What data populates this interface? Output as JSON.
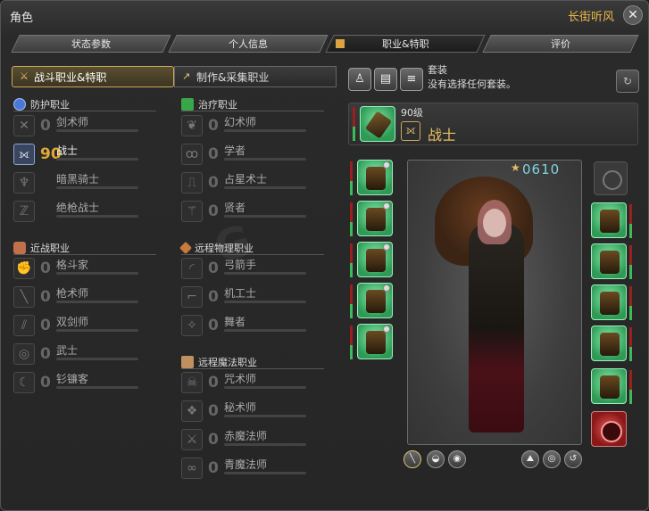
{
  "window": {
    "title": "角色",
    "character_name": "长街听风"
  },
  "tabs": [
    {
      "label": "状态参数"
    },
    {
      "label": "个人信息"
    },
    {
      "label": "职业&特职"
    },
    {
      "label": "评价"
    }
  ],
  "subtabs": [
    {
      "label": "战斗职业&特职"
    },
    {
      "label": "制作&采集职业"
    }
  ],
  "sections": {
    "tank": {
      "title": "防护职业",
      "jobs": [
        {
          "name": "剑术师",
          "level": "0"
        },
        {
          "name": "战士",
          "level": "90"
        },
        {
          "name": "暗黑骑士",
          "level": ""
        },
        {
          "name": "绝枪战士",
          "level": ""
        }
      ]
    },
    "melee": {
      "title": "近战职业",
      "jobs": [
        {
          "name": "格斗家",
          "level": "0"
        },
        {
          "name": "枪术师",
          "level": "0"
        },
        {
          "name": "双剑师",
          "level": "0"
        },
        {
          "name": "武士",
          "level": "0"
        },
        {
          "name": "钐镰客",
          "level": "0"
        }
      ]
    },
    "healer": {
      "title": "治疗职业",
      "jobs": [
        {
          "name": "幻术师",
          "level": "0"
        },
        {
          "name": "学者",
          "level": "0"
        },
        {
          "name": "占星术士",
          "level": "0"
        },
        {
          "name": "贤者",
          "level": "0"
        }
      ]
    },
    "ranged": {
      "title": "远程物理职业",
      "jobs": [
        {
          "name": "弓箭手",
          "level": "0"
        },
        {
          "name": "机工士",
          "level": "0"
        },
        {
          "name": "舞者",
          "level": "0"
        }
      ]
    },
    "caster": {
      "title": "远程魔法职业",
      "jobs": [
        {
          "name": "咒术师",
          "level": "0"
        },
        {
          "name": "秘术师",
          "level": "0"
        },
        {
          "name": "赤魔法师",
          "level": "0"
        },
        {
          "name": "青魔法师",
          "level": "0"
        }
      ]
    }
  },
  "gearset": {
    "label": "套装",
    "value": "没有选择任何套装。"
  },
  "weapon": {
    "level": "90级",
    "job": "战士"
  },
  "item_level": "0610",
  "icons": {
    "close": "close-icon",
    "shield": "shield-icon",
    "heal": "cross-icon",
    "melee": "fist-icon",
    "ranged": "bow-icon",
    "caster": "staff-icon"
  },
  "colors": {
    "accent": "#e0a838",
    "item_level": "#7fd4e0",
    "gear_green": "#2e9a55"
  }
}
